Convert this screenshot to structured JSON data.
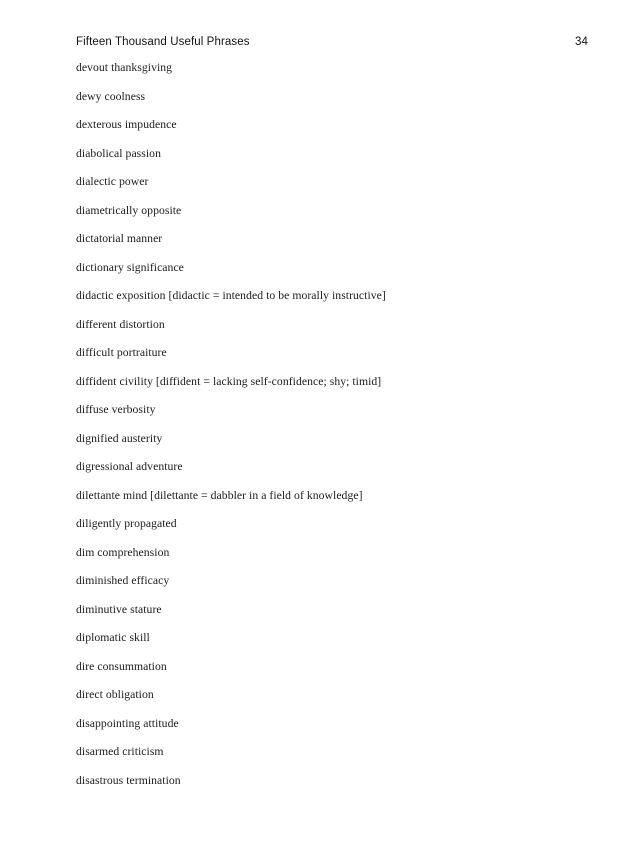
{
  "document": {
    "book_title": "Fifteen Thousand Useful Phrases",
    "page_number": "34"
  },
  "entries": [
    {
      "text": "devout thanksgiving"
    },
    {
      "text": "dewy coolness"
    },
    {
      "text": "dexterous impudence"
    },
    {
      "text": "diabolical passion"
    },
    {
      "text": "dialectic power"
    },
    {
      "text": "diametrically opposite"
    },
    {
      "text": "dictatorial manner"
    },
    {
      "text": "dictionary significance"
    },
    {
      "text": "didactic exposition [didactic = intended to be morally instructive]"
    },
    {
      "text": "different distortion"
    },
    {
      "text": "difficult portraiture"
    },
    {
      "text": "diffident civility [diffident = lacking self-confidence; shy; timid]"
    },
    {
      "text": "diffuse verbosity"
    },
    {
      "text": "dignified austerity"
    },
    {
      "text": "digressional adventure"
    },
    {
      "text": "dilettante mind [dilettante = dabbler in a field of knowledge]"
    },
    {
      "text": "diligently propagated"
    },
    {
      "text": "dim comprehension"
    },
    {
      "text": "diminished efficacy"
    },
    {
      "text": "diminutive stature"
    },
    {
      "text": "diplomatic skill"
    },
    {
      "text": "dire consummation"
    },
    {
      "text": "direct obligation"
    },
    {
      "text": "disappointing attitude"
    },
    {
      "text": "disarmed criticism"
    },
    {
      "text": "disastrous termination"
    }
  ]
}
